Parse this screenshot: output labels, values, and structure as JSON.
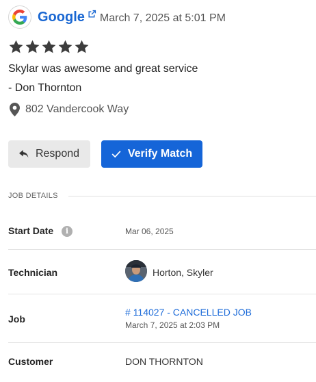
{
  "review": {
    "source": "Google",
    "date": "March 7, 2025 at 5:01 PM",
    "rating": 5,
    "text": "Skylar was awesome and great service",
    "author": "- Don Thornton",
    "location": "802 Vandercook Way"
  },
  "actions": {
    "respond_label": "Respond",
    "verify_label": "Verify Match"
  },
  "job_details": {
    "section_title": "JOB DETAILS",
    "start_date_label": "Start Date",
    "start_date_value": "Mar 06, 2025",
    "technician_label": "Technician",
    "technician_value": "Horton, Skyler",
    "job_label": "Job",
    "job_link": "# 114027 - CANCELLED JOB",
    "job_date": "March 7, 2025 at 2:03 PM",
    "customer_label": "Customer",
    "customer_value": "DON THORNTON"
  },
  "colors": {
    "link": "#1967d2",
    "primary_button": "#1565d8",
    "secondary_button": "#e9e9e9",
    "star": "#3c3c3c"
  },
  "icons": [
    "google-logo-icon",
    "external-link-icon",
    "star-icon",
    "map-pin-icon",
    "reply-icon",
    "check-icon",
    "info-icon",
    "avatar"
  ]
}
